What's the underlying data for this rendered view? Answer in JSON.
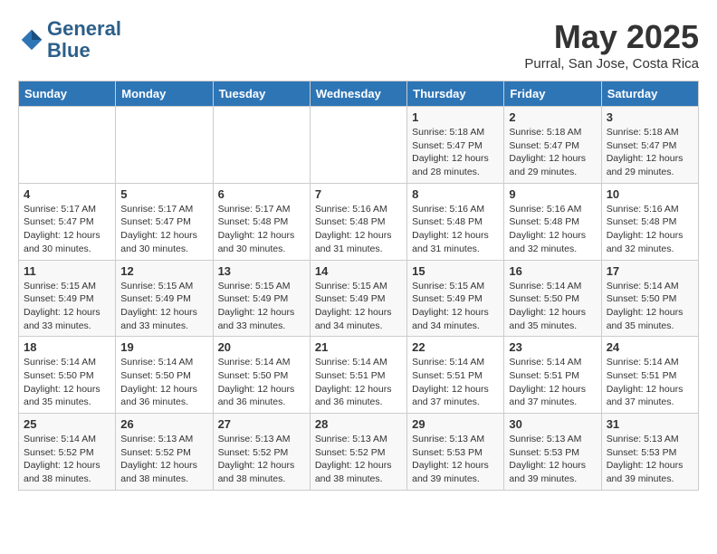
{
  "logo": {
    "line1": "General",
    "line2": "Blue"
  },
  "title": "May 2025",
  "location": "Purral, San Jose, Costa Rica",
  "weekdays": [
    "Sunday",
    "Monday",
    "Tuesday",
    "Wednesday",
    "Thursday",
    "Friday",
    "Saturday"
  ],
  "weeks": [
    [
      {
        "day": "",
        "info": ""
      },
      {
        "day": "",
        "info": ""
      },
      {
        "day": "",
        "info": ""
      },
      {
        "day": "",
        "info": ""
      },
      {
        "day": "1",
        "info": "Sunrise: 5:18 AM\nSunset: 5:47 PM\nDaylight: 12 hours\nand 28 minutes."
      },
      {
        "day": "2",
        "info": "Sunrise: 5:18 AM\nSunset: 5:47 PM\nDaylight: 12 hours\nand 29 minutes."
      },
      {
        "day": "3",
        "info": "Sunrise: 5:18 AM\nSunset: 5:47 PM\nDaylight: 12 hours\nand 29 minutes."
      }
    ],
    [
      {
        "day": "4",
        "info": "Sunrise: 5:17 AM\nSunset: 5:47 PM\nDaylight: 12 hours\nand 30 minutes."
      },
      {
        "day": "5",
        "info": "Sunrise: 5:17 AM\nSunset: 5:47 PM\nDaylight: 12 hours\nand 30 minutes."
      },
      {
        "day": "6",
        "info": "Sunrise: 5:17 AM\nSunset: 5:48 PM\nDaylight: 12 hours\nand 30 minutes."
      },
      {
        "day": "7",
        "info": "Sunrise: 5:16 AM\nSunset: 5:48 PM\nDaylight: 12 hours\nand 31 minutes."
      },
      {
        "day": "8",
        "info": "Sunrise: 5:16 AM\nSunset: 5:48 PM\nDaylight: 12 hours\nand 31 minutes."
      },
      {
        "day": "9",
        "info": "Sunrise: 5:16 AM\nSunset: 5:48 PM\nDaylight: 12 hours\nand 32 minutes."
      },
      {
        "day": "10",
        "info": "Sunrise: 5:16 AM\nSunset: 5:48 PM\nDaylight: 12 hours\nand 32 minutes."
      }
    ],
    [
      {
        "day": "11",
        "info": "Sunrise: 5:15 AM\nSunset: 5:49 PM\nDaylight: 12 hours\nand 33 minutes."
      },
      {
        "day": "12",
        "info": "Sunrise: 5:15 AM\nSunset: 5:49 PM\nDaylight: 12 hours\nand 33 minutes."
      },
      {
        "day": "13",
        "info": "Sunrise: 5:15 AM\nSunset: 5:49 PM\nDaylight: 12 hours\nand 33 minutes."
      },
      {
        "day": "14",
        "info": "Sunrise: 5:15 AM\nSunset: 5:49 PM\nDaylight: 12 hours\nand 34 minutes."
      },
      {
        "day": "15",
        "info": "Sunrise: 5:15 AM\nSunset: 5:49 PM\nDaylight: 12 hours\nand 34 minutes."
      },
      {
        "day": "16",
        "info": "Sunrise: 5:14 AM\nSunset: 5:50 PM\nDaylight: 12 hours\nand 35 minutes."
      },
      {
        "day": "17",
        "info": "Sunrise: 5:14 AM\nSunset: 5:50 PM\nDaylight: 12 hours\nand 35 minutes."
      }
    ],
    [
      {
        "day": "18",
        "info": "Sunrise: 5:14 AM\nSunset: 5:50 PM\nDaylight: 12 hours\nand 35 minutes."
      },
      {
        "day": "19",
        "info": "Sunrise: 5:14 AM\nSunset: 5:50 PM\nDaylight: 12 hours\nand 36 minutes."
      },
      {
        "day": "20",
        "info": "Sunrise: 5:14 AM\nSunset: 5:50 PM\nDaylight: 12 hours\nand 36 minutes."
      },
      {
        "day": "21",
        "info": "Sunrise: 5:14 AM\nSunset: 5:51 PM\nDaylight: 12 hours\nand 36 minutes."
      },
      {
        "day": "22",
        "info": "Sunrise: 5:14 AM\nSunset: 5:51 PM\nDaylight: 12 hours\nand 37 minutes."
      },
      {
        "day": "23",
        "info": "Sunrise: 5:14 AM\nSunset: 5:51 PM\nDaylight: 12 hours\nand 37 minutes."
      },
      {
        "day": "24",
        "info": "Sunrise: 5:14 AM\nSunset: 5:51 PM\nDaylight: 12 hours\nand 37 minutes."
      }
    ],
    [
      {
        "day": "25",
        "info": "Sunrise: 5:14 AM\nSunset: 5:52 PM\nDaylight: 12 hours\nand 38 minutes."
      },
      {
        "day": "26",
        "info": "Sunrise: 5:13 AM\nSunset: 5:52 PM\nDaylight: 12 hours\nand 38 minutes."
      },
      {
        "day": "27",
        "info": "Sunrise: 5:13 AM\nSunset: 5:52 PM\nDaylight: 12 hours\nand 38 minutes."
      },
      {
        "day": "28",
        "info": "Sunrise: 5:13 AM\nSunset: 5:52 PM\nDaylight: 12 hours\nand 38 minutes."
      },
      {
        "day": "29",
        "info": "Sunrise: 5:13 AM\nSunset: 5:53 PM\nDaylight: 12 hours\nand 39 minutes."
      },
      {
        "day": "30",
        "info": "Sunrise: 5:13 AM\nSunset: 5:53 PM\nDaylight: 12 hours\nand 39 minutes."
      },
      {
        "day": "31",
        "info": "Sunrise: 5:13 AM\nSunset: 5:53 PM\nDaylight: 12 hours\nand 39 minutes."
      }
    ]
  ]
}
